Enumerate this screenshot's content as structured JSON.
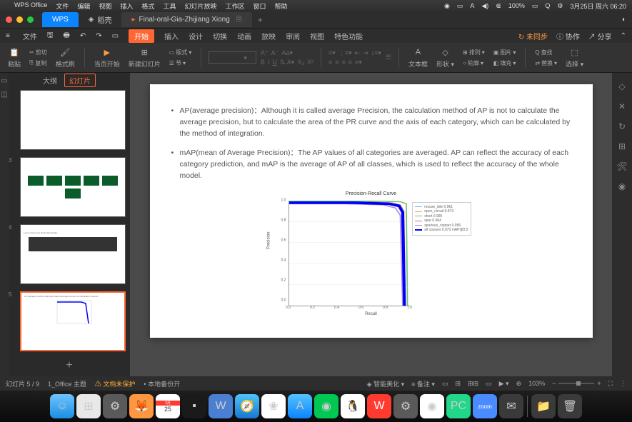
{
  "macos_menubar": {
    "app_name": "WPS Office",
    "items": [
      "文件",
      "编辑",
      "视图",
      "插入",
      "格式",
      "工具",
      "幻灯片放映",
      "工作区",
      "窗口",
      "帮助"
    ],
    "right": {
      "battery": "100%",
      "date": "3月25日 周六 06:20"
    }
  },
  "window_tabs": {
    "wps": "WPS",
    "daohang": "稻壳",
    "doc": "Final-oral-Gia-Zhijiang Xiong"
  },
  "ribbon_tabs": {
    "file": "文件",
    "tabs": [
      "开始",
      "插入",
      "设计",
      "切换",
      "动画",
      "放映",
      "审阅",
      "视图",
      "特色功能"
    ],
    "right": {
      "unsync": "未同步",
      "coop": "协作",
      "share": "分享"
    }
  },
  "toolbar": {
    "paste": "粘贴",
    "cut": "剪切",
    "copy": "复制",
    "format_painter": "格式刷",
    "current_start": "当页开始",
    "new_slide": "新建幻灯片",
    "layout": "版式",
    "section": "节",
    "textbox": "文本框",
    "shape": "形状",
    "arrange": "排列",
    "outline": "轮廓",
    "picture": "图片",
    "fill": "填充",
    "find": "查找",
    "replace": "替换",
    "select": "选择"
  },
  "side_panel": {
    "tab_outline": "大纲",
    "tab_slides": "幻灯片"
  },
  "slide_content": {
    "bullet1": "AP(average precision)：Although it is called average Precision, the calculation method of AP is not to calculate the average precision, but to calculate the area of the PR curve and the axis of each category, which can be calculated by the method of integration.",
    "bullet2": "mAP(mean of Average Precision)：The AP values of all categories are averaged. AP can reflect the accuracy of each category prediction, and mAP is the average of AP of all classes, which is used to reflect the accuracy of the whole model."
  },
  "chart_data": {
    "type": "line",
    "title": "Precision-Recall Curve",
    "xlabel": "Recall",
    "ylabel": "Precision",
    "xlim": [
      0.0,
      1.0
    ],
    "ylim": [
      0.0,
      1.0
    ],
    "x_ticks": [
      "0.0",
      "0.2",
      "0.4",
      "0.6",
      "0.8",
      "1.0"
    ],
    "y_ticks": [
      "0.0",
      "0.2",
      "0.4",
      "0.6",
      "0.8",
      "1.0"
    ],
    "series": [
      {
        "name": "mouse_bite 0.961",
        "color": "#7fb5e6"
      },
      {
        "name": "open_circuit 0.973",
        "color": "#f5a65b"
      },
      {
        "name": "short 0.995",
        "color": "#6fc16f"
      },
      {
        "name": "spur 0.964",
        "color": "#d66b6b"
      },
      {
        "name": "spurious_copper 0.956",
        "color": "#b28dd4"
      },
      {
        "name": "all classes 0.970 mAP@0.5",
        "color": "#0000ff"
      }
    ],
    "notes": "all series start near (0,1), stay at precision ~0.97-1.0 until recall ~0.93-0.96, then drop to precision 0 at recall 1.0"
  },
  "status_bar": {
    "slide_counter": "幻灯片 5 / 9",
    "theme": "1_Office 主题",
    "unprotected": "文档未保护",
    "local_backup": "本地备份开",
    "beautify": "智能美化",
    "notes": "备注",
    "zoom_pct": "103%"
  },
  "dock_apps": [
    "Finder",
    "Launchpad",
    "Settings",
    "Firefox",
    "Calendar-25",
    "Terminal",
    "WeChat-Work",
    "Safari",
    "Photos",
    "AppStore",
    "WeChat",
    "QQ",
    "WPS",
    "Settings2",
    "Chrome",
    "PyCharm",
    "Zoom",
    "Mail",
    "Files",
    "Trash"
  ]
}
